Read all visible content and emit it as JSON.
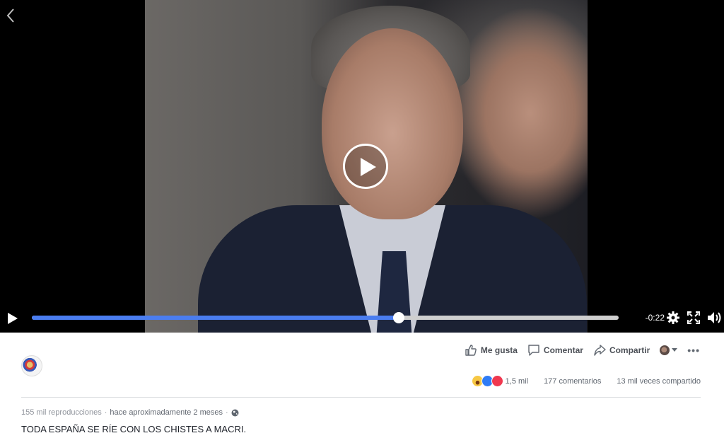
{
  "player": {
    "remaining_time": "-0:22",
    "progress_fraction": 0.625,
    "state": "paused"
  },
  "actions": {
    "like": "Me gusta",
    "comment": "Comentar",
    "share": "Compartir",
    "more": "•••"
  },
  "stats": {
    "reactions_count": "1,5 mil",
    "comments": "177 comentarios",
    "shares": "13 mil veces compartido"
  },
  "meta": {
    "views": "155 mil reproducciones",
    "separator": "·",
    "time": "hace aproximadamente 2 meses"
  },
  "caption": "TODA ESPAÑA SE RÍE CON LOS CHISTES A MACRI.",
  "colors": {
    "progress": "#4a7df0",
    "link_text": "#4b4f56",
    "meta_text": "#90949c"
  },
  "icons": {
    "reactions": [
      "haha-reaction-icon",
      "like-reaction-icon",
      "love-reaction-icon"
    ]
  }
}
